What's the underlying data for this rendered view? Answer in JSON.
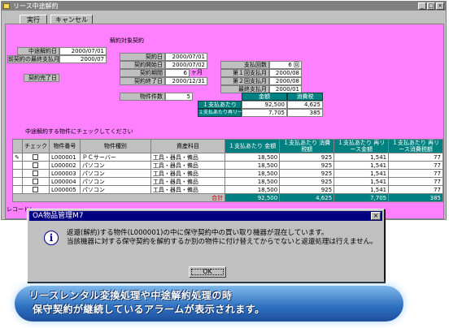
{
  "window": {
    "title": "リース中途解約",
    "buttons": {
      "minimize": "_",
      "maximize": "□",
      "close": "×"
    }
  },
  "toolbar": {
    "execute_label": "実行",
    "cancel_label": "キャンセル"
  },
  "left_form": {
    "cancel_date_label": "中途解約日",
    "cancel_date_value": "2000/07/01",
    "prev_last_payment_label": "前契約の最終支払月",
    "prev_last_payment_value": "2000/07",
    "end_date_label": "契約完了日"
  },
  "contract": {
    "section_title": "解約対象契約",
    "contract_date_label": "契約日",
    "contract_date_value": "2000/07/01",
    "start_date_label": "契約開始日",
    "start_date_value": "2000/07/02",
    "period_label": "契約期間",
    "period_value": "6",
    "period_unit": "ヶ月",
    "end_date_label": "契約終了日",
    "end_date_value": "2000/12/31",
    "payment_count_label": "支払回数",
    "payment_count_value": "6 回",
    "first_payment_label": "第１回支払月",
    "first_payment_value": "2000/08",
    "second_payment_label": "第２回支払月",
    "second_payment_value": "2000/08",
    "last_payment_label": "最終支払月",
    "last_payment_value": "2000/01",
    "item_count_label": "物件件数",
    "item_count_value": "5",
    "amount_header": "金額",
    "tax_header": "消費税",
    "per_payment_label": "１支払あたり",
    "per_payment_amount": "92,500",
    "per_payment_tax": "4,625",
    "per_release_label": "１支払あたり再リース",
    "per_release_amount": "7,705",
    "per_release_tax": "385"
  },
  "grid": {
    "caption": "中途解約する物件にチェックしてください",
    "headers": [
      "",
      "チェック",
      "物件番号",
      "物件種別",
      "資産科目",
      "１支払あたり 金額",
      "１支払あたり 消費税額",
      "１支払あたり 再リース金額",
      "１支払あたり 再リース消費税額"
    ],
    "rows": [
      {
        "marker": "✎",
        "no": "L000001",
        "type": "ＰＣサーバー",
        "subject": "工具・器具・備品",
        "amount": "18,500",
        "tax": "925",
        "release": "1,541",
        "release_tax": "77"
      },
      {
        "marker": "",
        "no": "L000002",
        "type": "パソコン",
        "subject": "工具・器具・備品",
        "amount": "18,500",
        "tax": "925",
        "release": "1,541",
        "release_tax": "77"
      },
      {
        "marker": "",
        "no": "L000003",
        "type": "パソコン",
        "subject": "工具・器具・備品",
        "amount": "18,500",
        "tax": "925",
        "release": "1,541",
        "release_tax": "77"
      },
      {
        "marker": "",
        "no": "L000004",
        "type": "パソコン",
        "subject": "工具・器具・備品",
        "amount": "18,500",
        "tax": "925",
        "release": "1,541",
        "release_tax": "77"
      },
      {
        "marker": "",
        "no": "L000005",
        "type": "パソコン",
        "subject": "工具・器具・備品",
        "amount": "18,500",
        "tax": "925",
        "release": "1,541",
        "release_tax": "77"
      }
    ],
    "total_label": "合計",
    "total_amount": "92,500",
    "total_tax": "4,625",
    "total_release": "7,705",
    "total_release_tax": "385",
    "record_label": "レコード："
  },
  "dialog": {
    "title": "OA物品管理M7",
    "close": "×",
    "line1": "返還(解約)する物件(L000001)の中に保守契約中の買い取り機器が混在しています。",
    "line2": "当該機器に対する保守契約を解約するか別の物件に付け替えてからでないと返還処理は行えません。",
    "ok_label": "OK"
  },
  "banner": {
    "line1": "リースレンタル変換処理や中途解約処理の時",
    "line2": "保守契約が継続しているアラームが表示されます。"
  }
}
